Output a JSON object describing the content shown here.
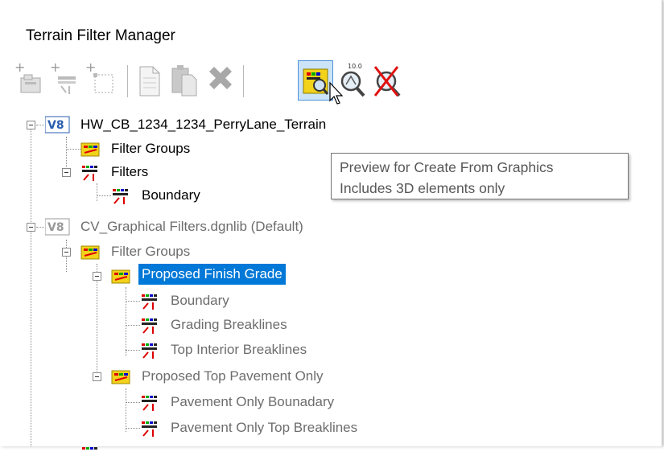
{
  "window": {
    "title": "Terrain Filter Manager"
  },
  "toolbar": {
    "buttons": [
      {
        "name": "new-filter-group-icon"
      },
      {
        "name": "new-filter-icon"
      },
      {
        "name": "new-selection-icon"
      },
      {
        "name": "copy-icon"
      },
      {
        "name": "paste-icon"
      },
      {
        "name": "delete-icon"
      },
      {
        "name": "preview-create-from-graphics-icon",
        "active": true
      },
      {
        "name": "zoom-preview-icon"
      },
      {
        "name": "clear-preview-icon"
      }
    ],
    "tooltip_line1": "Preview for Create From Graphics",
    "tooltip_line2": "Includes 3D elements only"
  },
  "tree": {
    "file1": {
      "label": "HW_CB_1234_1234_PerryLane_Terrain",
      "badge": "V8",
      "filter_groups": "Filter Groups",
      "filters": "Filters",
      "boundary": "Boundary"
    },
    "lib": {
      "label": "CV_Graphical Filters.dgnlib (Default)",
      "badge": "V8",
      "filter_groups": "Filter Groups",
      "group1": {
        "label": "Proposed Finish Grade",
        "items": [
          "Boundary",
          "Grading Breaklines",
          "Top Interior Breaklines"
        ]
      },
      "group2": {
        "label": "Proposed Top Pavement Only",
        "items": [
          "Pavement Only Bounadary",
          "Pavement Only Top Breaklines"
        ]
      }
    }
  },
  "colors": {
    "selection": "#0078d7",
    "tooltip_text": "#575757",
    "disabled_text": "#6d6d6d"
  }
}
